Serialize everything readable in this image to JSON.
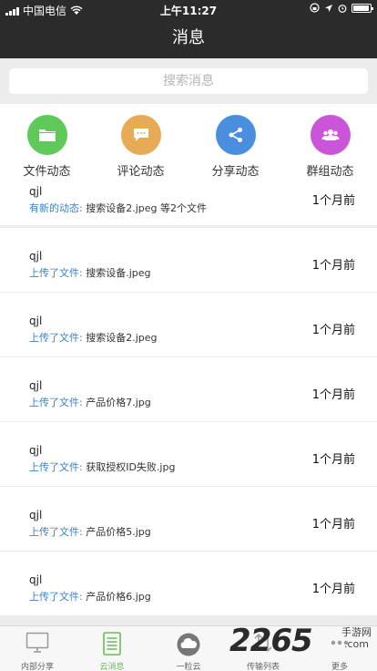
{
  "status_bar": {
    "carrier": "中国电信",
    "time": "上午11:27"
  },
  "header": {
    "title": "消息"
  },
  "search": {
    "placeholder": "搜索消息"
  },
  "categories": [
    {
      "label": "文件动态",
      "icon": "folder-icon",
      "color": "#5fca5a"
    },
    {
      "label": "评论动态",
      "icon": "comment-icon",
      "color": "#e7aa55"
    },
    {
      "label": "分享动态",
      "icon": "share-icon",
      "color": "#4a8fde"
    },
    {
      "label": "群组动态",
      "icon": "group-icon",
      "color": "#cb55d8"
    }
  ],
  "messages": [
    {
      "user": "qjl",
      "action": "有新的动态:",
      "file": "搜索设备2.jpeg 等2个文件",
      "time": "1个月前"
    },
    {
      "user": "qjl",
      "action": "上传了文件:",
      "file": "搜索设备.jpeg",
      "time": "1个月前"
    },
    {
      "user": "qjl",
      "action": "上传了文件:",
      "file": "搜索设备2.jpeg",
      "time": "1个月前"
    },
    {
      "user": "qjl",
      "action": "上传了文件:",
      "file": "产品价格7.jpg",
      "time": "1个月前"
    },
    {
      "user": "qjl",
      "action": "上传了文件:",
      "file": "获取授权ID失败.jpg",
      "time": "1个月前"
    },
    {
      "user": "qjl",
      "action": "上传了文件:",
      "file": "产品价格5.jpg",
      "time": "1个月前"
    },
    {
      "user": "qjl",
      "action": "上传了文件:",
      "file": "产品价格6.jpg",
      "time": "1个月前"
    }
  ],
  "tabs": [
    {
      "label": "内部分享",
      "icon": "monitor-icon"
    },
    {
      "label": "云消息",
      "icon": "message-list-icon",
      "active": true
    },
    {
      "label": "一粒云",
      "icon": "cloud-icon"
    },
    {
      "label": "传输列表",
      "icon": "transfer-icon"
    },
    {
      "label": "更多",
      "icon": "more-icon"
    }
  ],
  "watermark": {
    "number": "2265",
    "suffix": ".com",
    "tag": "手游网"
  },
  "colors": {
    "bar": "#2b2b2b",
    "link": "#3b82c4",
    "active_tab": "#6fba58"
  }
}
